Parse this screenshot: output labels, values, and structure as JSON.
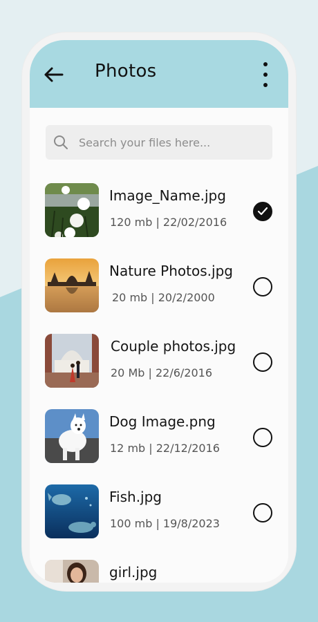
{
  "colors": {
    "appbar": "#a8d9e1",
    "background_light": "#e4eff2",
    "background_accent": "#a9d7e0",
    "selected": "#111111"
  },
  "header": {
    "title": "Photos",
    "back_icon": "arrow-left-icon",
    "menu_icon": "more-vertical-icon"
  },
  "search": {
    "placeholder": "Search your files here...",
    "value": "",
    "icon": "search-icon"
  },
  "files": [
    {
      "name": "Image_Name.jpg",
      "meta": "120 mb | 22/02/2016",
      "selected": true,
      "thumb": "white-flowers"
    },
    {
      "name": "Nature Photos.jpg",
      "meta": "20 mb | 20/2/2000",
      "selected": false,
      "thumb": "sunset-palace"
    },
    {
      "name": "Couple photos.jpg",
      "meta": "20 Mb | 22/6/2016",
      "selected": false,
      "thumb": "taj-mahal-couple"
    },
    {
      "name": "Dog Image.png",
      "meta": "12 mb | 22/12/2016",
      "selected": false,
      "thumb": "white-dog"
    },
    {
      "name": "Fish.jpg",
      "meta": "100 mb | 19/8/2023",
      "selected": false,
      "thumb": "underwater-turtle"
    },
    {
      "name": "girl.jpg",
      "meta": "",
      "selected": false,
      "thumb": "girl-portrait"
    }
  ]
}
